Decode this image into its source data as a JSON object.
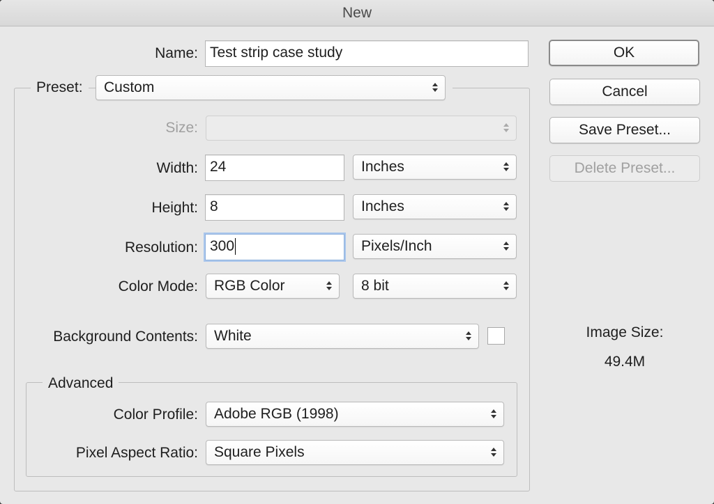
{
  "window": {
    "title": "New"
  },
  "name": {
    "label": "Name:",
    "value": "Test strip case study"
  },
  "preset": {
    "label": "Preset:",
    "value": "Custom"
  },
  "size": {
    "label": "Size:",
    "value": ""
  },
  "width": {
    "label": "Width:",
    "value": "24",
    "unit": "Inches"
  },
  "height": {
    "label": "Height:",
    "value": "8",
    "unit": "Inches"
  },
  "resolution": {
    "label": "Resolution:",
    "value": "300",
    "unit": "Pixels/Inch"
  },
  "color_mode": {
    "label": "Color Mode:",
    "value": "RGB Color",
    "depth": "8 bit"
  },
  "background": {
    "label": "Background Contents:",
    "value": "White",
    "swatch_color": "#ffffff"
  },
  "advanced": {
    "title": "Advanced",
    "color_profile": {
      "label": "Color Profile:",
      "value": "Adobe RGB (1998)"
    },
    "pixel_aspect": {
      "label": "Pixel Aspect Ratio:",
      "value": "Square Pixels"
    }
  },
  "buttons": {
    "ok": "OK",
    "cancel": "Cancel",
    "save_preset": "Save Preset...",
    "delete_preset": "Delete Preset..."
  },
  "image_size": {
    "label": "Image Size:",
    "value": "49.4M"
  },
  "colors": {
    "dialog_bg": "#e8e8e8",
    "focus_ring": "#a9c6ec",
    "disabled_text": "#a0a0a0"
  }
}
